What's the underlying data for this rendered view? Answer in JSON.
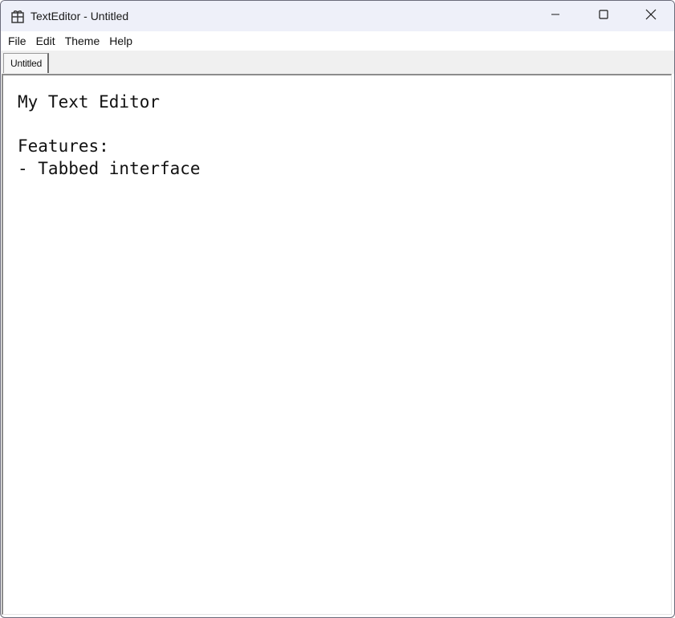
{
  "window": {
    "title": "TextEditor - Untitled",
    "app_icon": "app-icon",
    "controls": {
      "minimize_icon": "minimize-icon",
      "maximize_icon": "maximize-icon",
      "close_icon": "close-icon"
    }
  },
  "menubar": {
    "items": [
      {
        "label": "File"
      },
      {
        "label": "Edit"
      },
      {
        "label": "Theme"
      },
      {
        "label": "Help"
      }
    ]
  },
  "tabs": [
    {
      "label": "Untitled",
      "active": true
    }
  ],
  "editor": {
    "lines": [
      "My Text Editor",
      "",
      "Features:",
      "- Tabbed interface"
    ]
  },
  "colors": {
    "titlebar_bg": "#eef0f9",
    "tabstrip_bg": "#f0f0f0",
    "editor_bg": "#ffffff",
    "text": "#111111"
  }
}
